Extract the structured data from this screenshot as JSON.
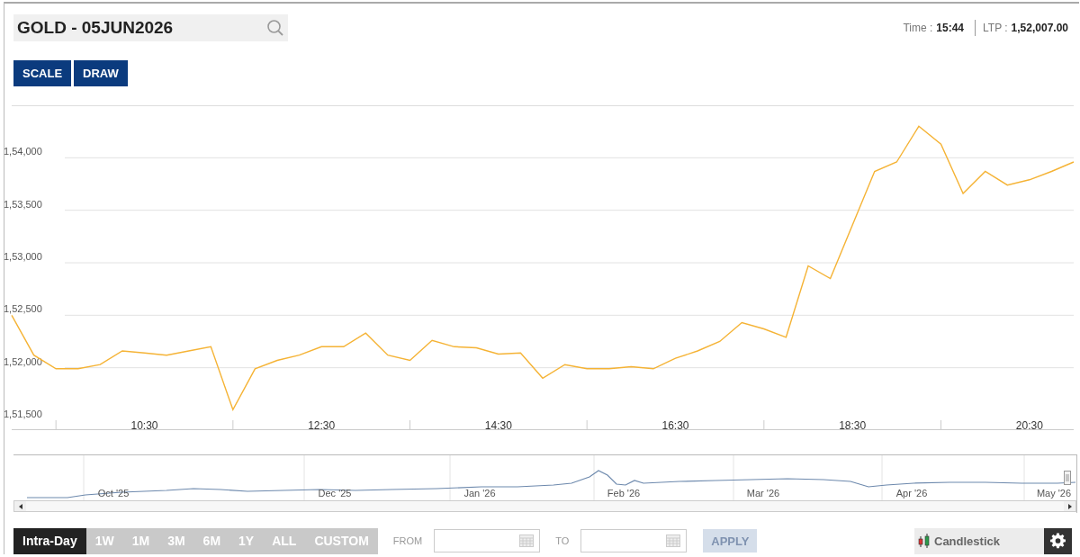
{
  "symbol_search": {
    "value": "GOLD - 05JUN2026"
  },
  "quote": {
    "time_label": "Time :",
    "time": "15:44",
    "ltp_label": "LTP :",
    "ltp": "1,52,007.00"
  },
  "tool_buttons": [
    "SCALE",
    "DRAW"
  ],
  "chart": {
    "chart_data": {
      "type": "line",
      "grid": true,
      "x": [
        9,
        9.25,
        9.5,
        9.75,
        10,
        10.25,
        10.5,
        10.75,
        11,
        11.25,
        11.5,
        11.75,
        12,
        12.25,
        12.5,
        12.75,
        13,
        13.25,
        13.5,
        13.75,
        14,
        14.25,
        14.5,
        14.75,
        15,
        15.25,
        15.5,
        15.75,
        16,
        16.25,
        16.5,
        16.75,
        17,
        17.25,
        17.5,
        17.75,
        18,
        18.25,
        18.5,
        18.75,
        19,
        19.25,
        19.5,
        19.75,
        20,
        20.25,
        20.5,
        20.75,
        21
      ],
      "series": [
        {
          "color": "#f5b335",
          "values": [
            152500,
            152120,
            151990,
            151990,
            152030,
            152160,
            152140,
            152120,
            152160,
            152200,
            151600,
            151990,
            152070,
            152120,
            152200,
            152200,
            152330,
            152120,
            152070,
            152260,
            152200,
            152190,
            152130,
            152140,
            151900,
            152030,
            151990,
            151990,
            152010,
            151990,
            152090,
            152160,
            152250,
            152430,
            152370,
            152290,
            152970,
            152850,
            153360,
            153870,
            153960,
            154300,
            154130,
            153660,
            153870,
            153740,
            153790,
            153870,
            153960
          ]
        }
      ],
      "xlim": [
        9,
        21
      ],
      "ylim": [
        151500,
        154500
      ],
      "xticks": [
        {
          "value": 10.5,
          "label": "10:30"
        },
        {
          "value": 12.5,
          "label": "12:30"
        },
        {
          "value": 14.5,
          "label": "14:30"
        },
        {
          "value": 16.5,
          "label": "16:30"
        },
        {
          "value": 18.5,
          "label": "18:30"
        },
        {
          "value": 20.5,
          "label": "20:30"
        }
      ],
      "yticks": [
        {
          "value": 151500,
          "label": "1,51,500"
        },
        {
          "value": 152000,
          "label": "1,52,000"
        },
        {
          "value": 152500,
          "label": "1,52,500"
        },
        {
          "value": 153000,
          "label": "1,53,000"
        },
        {
          "value": 153500,
          "label": "1,53,500"
        },
        {
          "value": 154000,
          "label": "1,54,000"
        }
      ]
    }
  },
  "navigator": {
    "months": [
      "Oct '25",
      "Dec '25",
      "Jan '26",
      "Feb '26",
      "Mar '26",
      "Apr '26",
      "May '26"
    ]
  },
  "ranges": [
    {
      "label": "Intra-Day",
      "selected": true
    },
    {
      "label": "1W",
      "selected": false
    },
    {
      "label": "1M",
      "selected": false
    },
    {
      "label": "3M",
      "selected": false
    },
    {
      "label": "6M",
      "selected": false
    },
    {
      "label": "1Y",
      "selected": false
    },
    {
      "label": "ALL",
      "selected": false
    },
    {
      "label": "CUSTOM",
      "selected": false
    }
  ],
  "date_range": {
    "from_label": "FROM",
    "to_label": "TO",
    "apply": "APPLY",
    "disabled": true
  },
  "chart_type": {
    "value": "Candlestick"
  }
}
